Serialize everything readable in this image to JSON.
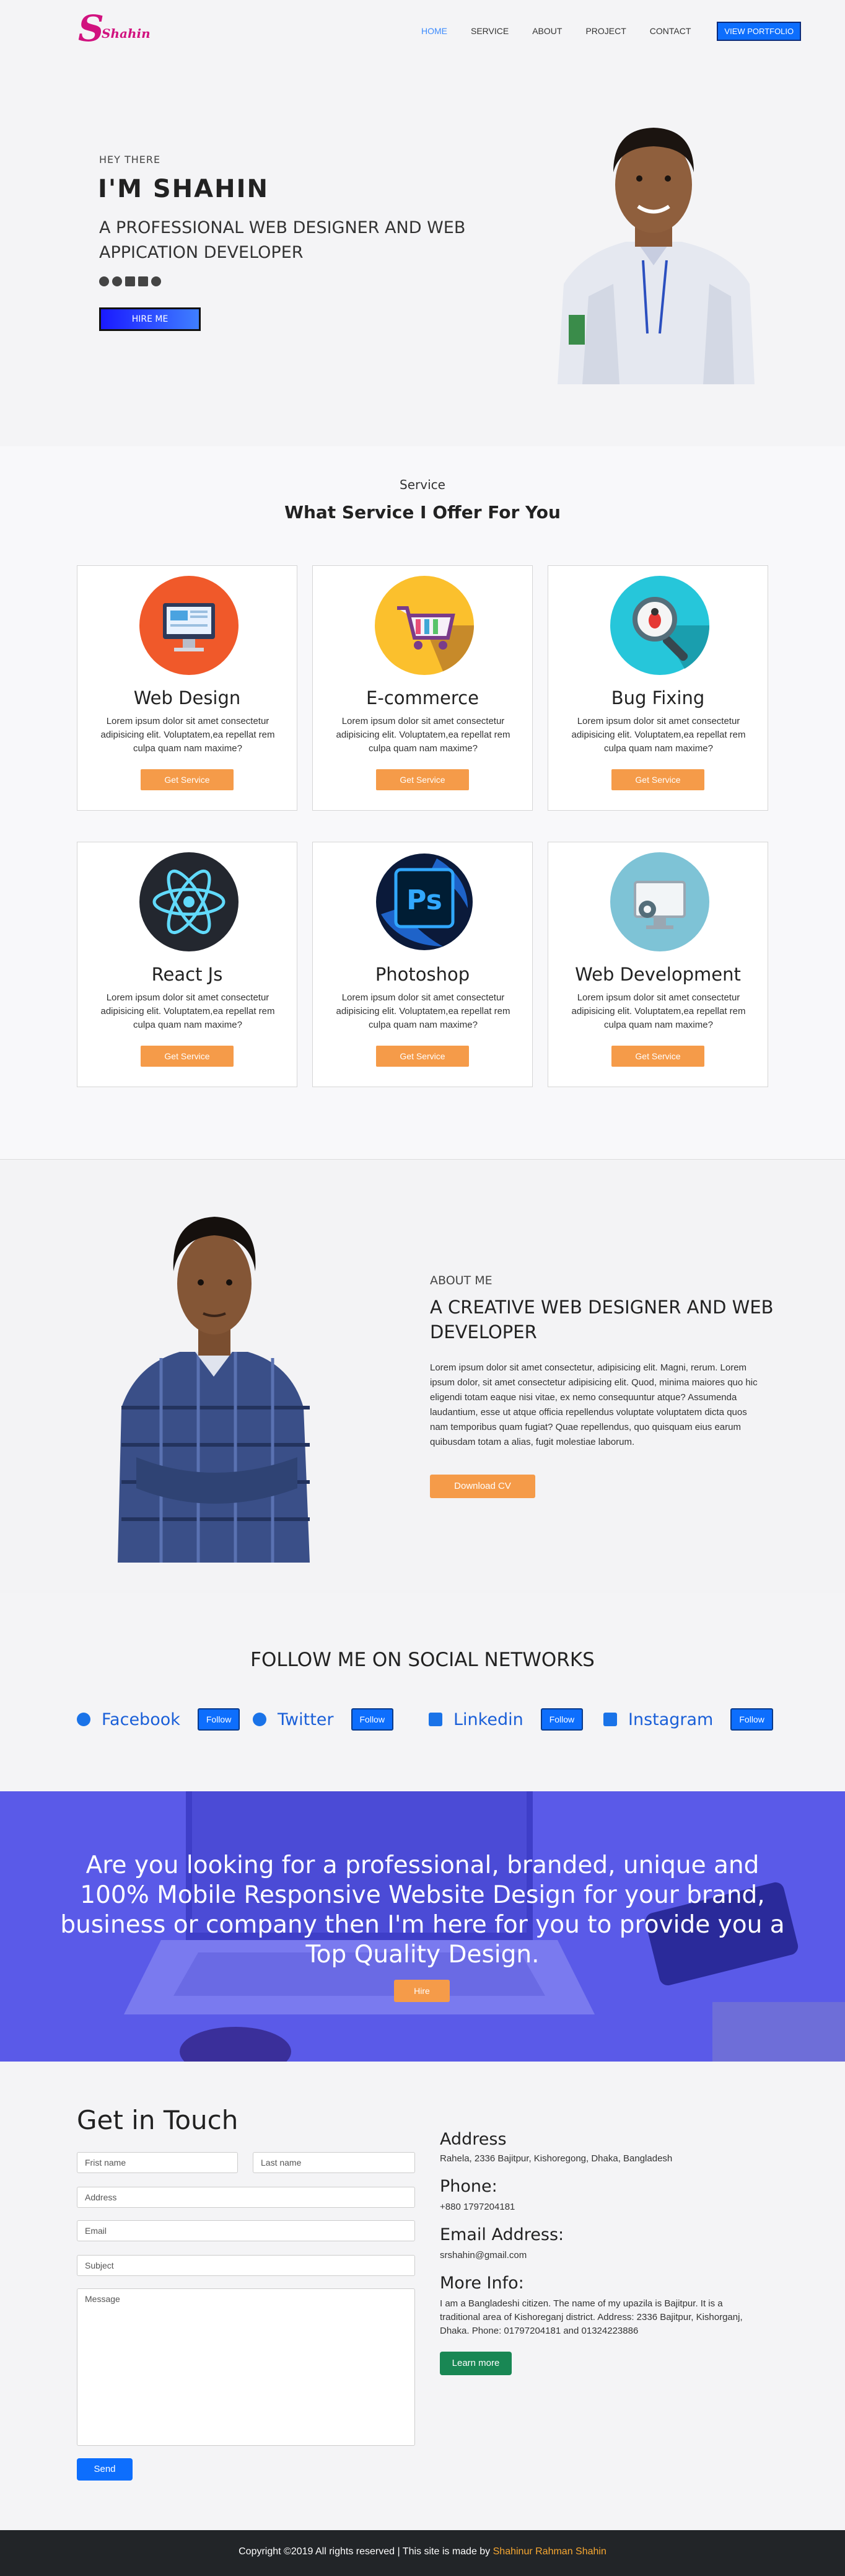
{
  "nav": {
    "logo_letter": "S",
    "logo_text": "Shahin",
    "items": [
      {
        "label": "HOME",
        "active": true
      },
      {
        "label": "SERVICE",
        "active": false
      },
      {
        "label": "ABOUT",
        "active": false
      },
      {
        "label": "PROJECT",
        "active": false
      },
      {
        "label": "CONTACT",
        "active": false
      }
    ],
    "portfolio_button": "VIEW PORTFOLIO"
  },
  "hero": {
    "greeting": "HEY  THERE",
    "name": "I'M SHAHIN",
    "subtitle": "A PROFESSIONAL WEB DESIGNER AND WEB APPICATION DEVELOPER",
    "social_icons": [
      "facebook-icon",
      "twitter-icon",
      "linkedin-icon",
      "instagram-icon",
      "github-icon"
    ],
    "hire_button": "HIRE ME"
  },
  "services": {
    "eyebrow": "Service",
    "title": "What Service I Offer For You",
    "button_label": "Get Service",
    "description": "Lorem ipsum dolor sit amet consectetur adipisicing elit. Voluptatem,ea repellat rem culpa quam nam maxime?",
    "cards": [
      {
        "title": "Web Design",
        "icon": "web-design-icon"
      },
      {
        "title": "E-commerce",
        "icon": "shopping-cart-icon"
      },
      {
        "title": "Bug Fixing",
        "icon": "magnifier-bug-icon"
      },
      {
        "title": "React Js",
        "icon": "react-icon"
      },
      {
        "title": "Photoshop",
        "icon": "photoshop-icon"
      },
      {
        "title": "Web Development",
        "icon": "monitor-gear-icon"
      }
    ]
  },
  "about": {
    "eyebrow": "ABOUT ME",
    "title": "A CREATIVE WEB DESIGNER AND WEB DEVELOPER",
    "text": "Lorem ipsum dolor sit amet consectetur, adipisicing elit. Magni, rerum. Lorem ipsum dolor, sit amet consectetur adipisicing elit. Quod, minima maiores quo hic eligendi totam eaque nisi vitae, ex nemo consequuntur atque? Assumenda laudantium, esse ut atque officia repellendus voluptate voluptatem dicta quos nam temporibus quam fugiat? Quae repellendus, quo quisquam eius earum quibusdam totam a alias, fugit molestiae laborum.",
    "download_button": "Download CV"
  },
  "social": {
    "title": "FOLLOW ME ON SOCIAL NETWORKS",
    "follow_label": "Follow",
    "networks": [
      {
        "name": "Facebook",
        "icon": "facebook-icon"
      },
      {
        "name": "Twitter",
        "icon": "twitter-icon"
      },
      {
        "name": "Linkedin",
        "icon": "linkedin-icon"
      },
      {
        "name": "Instagram",
        "icon": "instagram-icon"
      }
    ]
  },
  "cta": {
    "text": "Are you looking for a professional, branded, unique and 100% Mobile Responsive Website Design for your brand, business or company then I'm here for you to provide you a Top Quality Design.",
    "button": "Hire"
  },
  "contact": {
    "title": "Get in Touch",
    "fields": {
      "first_name": "Frist name",
      "last_name": "Last name",
      "address": "Address",
      "email": "Email",
      "subject": "Subject",
      "message": "Message"
    },
    "send_button": "Send",
    "address_heading": "Address",
    "address_value": "Rahela, 2336 Bajitpur, Kishoregong, Dhaka, Bangladesh",
    "phone_heading": "Phone:",
    "phone_value": "+880 1797204181",
    "email_heading": "Email Address:",
    "email_value": "srshahin@gmail.com",
    "more_heading": "More Info:",
    "more_value": "I am a Bangladeshi citizen. The name of my upazila is Bajitpur. It is a traditional area of Kishoreganj district. Address: 2336 Bajitpur, Kishorganj, Dhaka. Phone: 01797204181 and 01324223886",
    "learn_button": "Learn more"
  },
  "footer": {
    "text": "Copyright ©2019 All rights reserved | This site is made by ",
    "author": "Shahinur Rahman Shahin"
  },
  "colors": {
    "accent_orange": "#f59b49",
    "primary_blue": "#0d6efd",
    "brand_pink": "#d1127f",
    "cta_blue": "#5a5ae8",
    "footer_bg": "#222528"
  }
}
